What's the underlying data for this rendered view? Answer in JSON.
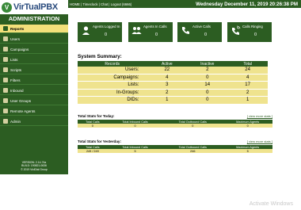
{
  "logo": {
    "text": "VirTualPBX"
  },
  "topbar": {
    "links": "HOME | Timeclock | Chat | Logout (6666)",
    "datetime": "Wednesday December 11, 2019 20:26:38 PM"
  },
  "sidebar": {
    "title": "ADMINISTRATION",
    "items": [
      {
        "label": "Reports",
        "active": true
      },
      {
        "label": "Users"
      },
      {
        "label": "Campaigns"
      },
      {
        "label": "Lists"
      },
      {
        "label": "Scripts"
      },
      {
        "label": "Filters"
      },
      {
        "label": "Inbound"
      },
      {
        "label": "User Groups"
      },
      {
        "label": "Remote Agents"
      },
      {
        "label": "Admin"
      }
    ],
    "version_lines": [
      "VERSION: 2.14-74a",
      "BUILD: 190821-0636",
      "© 2019 ViciDial Group"
    ]
  },
  "tiles": [
    {
      "label": "Agents Logged In",
      "value": "0",
      "icon": "agent-icon"
    },
    {
      "label": "Agents In Calls",
      "value": "0",
      "icon": "agents-in-calls-icon"
    },
    {
      "label": "Active Calls",
      "value": "0",
      "icon": "phone-icon"
    },
    {
      "label": "Calls Ringing",
      "value": "0",
      "icon": "ringing-phone-icon"
    }
  ],
  "summary": {
    "title": "System Summary:",
    "headers": [
      "Records",
      "Active",
      "Inactive",
      "Total"
    ],
    "rows": [
      {
        "label": "Users:",
        "active": "22",
        "inactive": "2",
        "total": "24"
      },
      {
        "label": "Campaigns:",
        "active": "4",
        "inactive": "0",
        "total": "4"
      },
      {
        "label": "Lists:",
        "active": "3",
        "inactive": "14",
        "total": "17"
      },
      {
        "label": "In-Groups:",
        "active": "2",
        "inactive": "0",
        "total": "2"
      },
      {
        "label": "DIDs:",
        "active": "1",
        "inactive": "0",
        "total": "1"
      }
    ]
  },
  "today": {
    "title": "Total Stats for Today:",
    "link": "[ view more stats ]",
    "headers": [
      "Total Calls",
      "Total Inbound Calls",
      "Total Outbound Calls",
      "Maximum Agents"
    ],
    "values": [
      "0",
      "0",
      "0",
      "0"
    ]
  },
  "yesterday": {
    "title": "Total Stats for Yesterday:",
    "link": "[ view more stats ]",
    "headers": [
      "Total Calls",
      "Total Inbound Calls",
      "Total Outbound Calls",
      "Maximum Agents"
    ],
    "values": [
      "249 / 249",
      "5",
      "246",
      "5"
    ]
  },
  "watermark": "Activate Windows",
  "colors": {
    "primary_green": "#2c5d22",
    "row_yellow": "#efe38e",
    "active_item": "#f3e07a"
  }
}
